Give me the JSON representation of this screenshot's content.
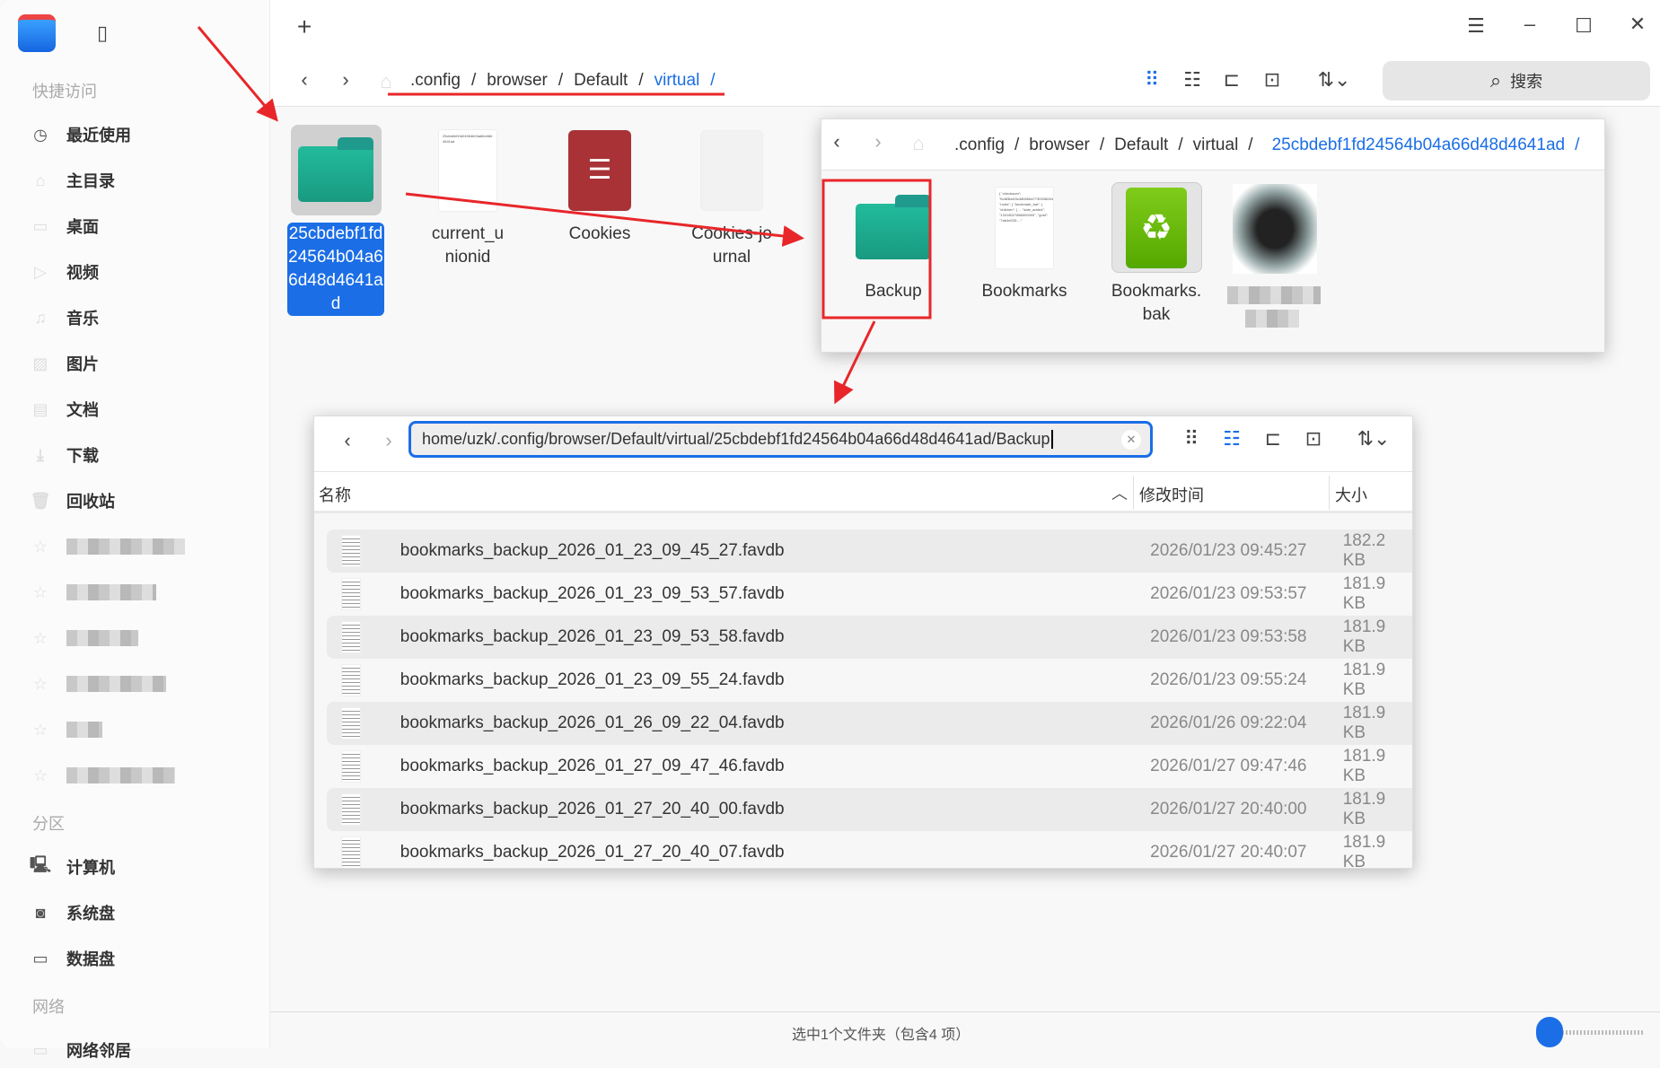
{
  "sidebar": {
    "quick_access": "快捷访问",
    "items": [
      "最近使用",
      "主目录",
      "桌面",
      "视频",
      "音乐",
      "图片",
      "文档",
      "下载",
      "回收站"
    ],
    "partitions": "分区",
    "drives": [
      "计算机",
      "系统盘",
      "数据盘"
    ],
    "network": "网络",
    "network_item": "网络邻居"
  },
  "toolbar": {
    "new_tab": "+",
    "breadcrumb": [
      ".config",
      "browser",
      "Default",
      "virtual"
    ],
    "sep": "/",
    "search": "搜索"
  },
  "grid": {
    "items": [
      {
        "name": "25cbdebf1fd24564b04a66d48d4641ad",
        "type": "folder"
      },
      {
        "name": "current_unionid",
        "type": "text",
        "preview": "25cbdebf1fd24564b04a66d48d4641ad"
      },
      {
        "name": "Cookies",
        "type": "database"
      },
      {
        "name": "Cookies-journal",
        "type": "file"
      }
    ]
  },
  "panel1": {
    "breadcrumb": [
      ".config",
      "browser",
      "Default",
      "virtual",
      "25cbdebf1fd24564b04a66d48d4641ad"
    ],
    "items": [
      {
        "name": "Backup",
        "type": "folder"
      },
      {
        "name": "Bookmarks",
        "type": "json",
        "preview": "{ \"checksum\": \"fcd83bc63c48b560a773f1f0824fa\", \"roots\": { \"bookmark_bar\": { \"children\": [ ... \"date_added\": \"13318027866000000\", \"guid\": \"7ab4e033-...\""
      },
      {
        "name": "Bookmarks.bak",
        "type": "backup"
      }
    ]
  },
  "panel2": {
    "address": "home/uzk/.config/browser/Default/virtual/25cbdebf1fd24564b04a66d48d4641ad/Backup",
    "columns": {
      "name": "名称",
      "modified": "修改时间",
      "size": "大小"
    },
    "rows": [
      {
        "name": "bookmarks_backup_2026_01_23_09_45_27.favdb",
        "date": "2026/01/23 09:45:27",
        "size": "182.2 KB"
      },
      {
        "name": "bookmarks_backup_2026_01_23_09_53_57.favdb",
        "date": "2026/01/23 09:53:57",
        "size": "181.9 KB"
      },
      {
        "name": "bookmarks_backup_2026_01_23_09_53_58.favdb",
        "date": "2026/01/23 09:53:58",
        "size": "181.9 KB"
      },
      {
        "name": "bookmarks_backup_2026_01_23_09_55_24.favdb",
        "date": "2026/01/23 09:55:24",
        "size": "181.9 KB"
      },
      {
        "name": "bookmarks_backup_2026_01_26_09_22_04.favdb",
        "date": "2026/01/26 09:22:04",
        "size": "181.9 KB"
      },
      {
        "name": "bookmarks_backup_2026_01_27_09_47_46.favdb",
        "date": "2026/01/27 09:47:46",
        "size": "181.9 KB"
      },
      {
        "name": "bookmarks_backup_2026_01_27_20_40_00.favdb",
        "date": "2026/01/27 20:40:00",
        "size": "181.9 KB"
      },
      {
        "name": "bookmarks_backup_2026_01_27_20_40_07.favdb",
        "date": "2026/01/27 20:40:07",
        "size": "181.9 KB"
      }
    ]
  },
  "status": {
    "text": "选中1个文件夹（包含4 项）",
    "icon_size_fraction": 0.05
  },
  "colors": {
    "accent": "#1b6ee6",
    "annotation": "#e8262a",
    "folder": "#20b596"
  }
}
